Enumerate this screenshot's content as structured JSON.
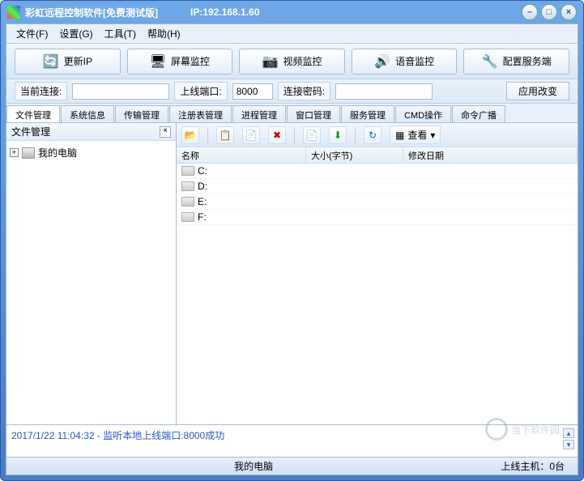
{
  "window": {
    "title": "彩虹远程控制软件[免费测试版]",
    "ip_label": "IP:192.168.1.60"
  },
  "menu": {
    "file": "文件(F)",
    "settings": "设置(G)",
    "tools": "工具(T)",
    "help": "帮助(H)"
  },
  "toolbar": {
    "refresh_ip": "更新IP",
    "screen_monitor": "屏幕监控",
    "video_monitor": "视频监控",
    "audio_monitor": "语音监控",
    "config_server": "配置服务端"
  },
  "connection": {
    "current_label": "当前连接:",
    "current_value": "",
    "port_label": "上线端口:",
    "port_value": "8000",
    "password_label": "连接密码:",
    "password_value": "",
    "apply_label": "应用改变"
  },
  "tabs": [
    "文件管理",
    "系统信息",
    "传输管理",
    "注册表管理",
    "进程管理",
    "窗口管理",
    "服务管理",
    "CMD操作",
    "命令广播"
  ],
  "sidebar": {
    "title": "文件管理",
    "root_label": "我的电脑"
  },
  "file_toolbar": {
    "view_label": "查看"
  },
  "columns": {
    "name": "名称",
    "size": "大小(字节)",
    "date": "修改日期"
  },
  "drives": [
    "C:",
    "D:",
    "E:",
    "F:"
  ],
  "log": {
    "entry": "2017/1/22 11:04:32 - 监听本地上线端口:8000成功"
  },
  "status": {
    "path": "我的电脑",
    "hosts_label": "上线主机：0台"
  },
  "watermark": {
    "text": "当下软件园"
  },
  "icons": {
    "refresh": "🔄",
    "monitor": "🖥",
    "camera": "📷",
    "speaker": "🔊",
    "gear": "🔧",
    "folder_up": "📂",
    "copy": "📋",
    "paste": "📄",
    "delete": "✖",
    "new": "📄",
    "download": "⬇",
    "refresh2": "↻",
    "grid": "▦",
    "chevron": "▾"
  }
}
